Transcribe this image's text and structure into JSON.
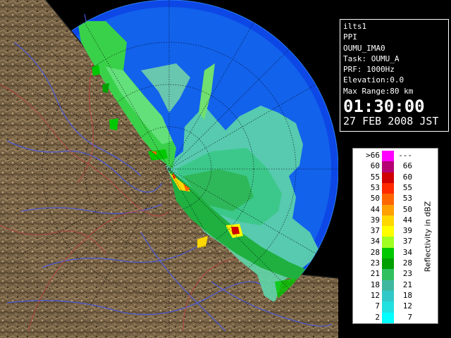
{
  "info": {
    "host": "ilts1",
    "mode": "PPI",
    "site": "OUMU_IMA0",
    "task": "Task: OUMU_A",
    "prf": "PRF: 1000Hz",
    "elevation": "Elevation:0.0",
    "max_range": "Max Range:80 km",
    "time": "01:30:00",
    "date": "27 FEB 2008 JST"
  },
  "legend": {
    "unit_label": "Reflectivity in dBZ",
    "rows": [
      {
        "low": ">66",
        "high": "---",
        "color": "#ff00ff"
      },
      {
        "low": "60",
        "high": "66",
        "color": "#b40070"
      },
      {
        "low": "55",
        "high": "60",
        "color": "#d00000"
      },
      {
        "low": "53",
        "high": "55",
        "color": "#ff2a00"
      },
      {
        "low": "50",
        "high": "53",
        "color": "#ff6600"
      },
      {
        "low": "44",
        "high": "50",
        "color": "#ffa000"
      },
      {
        "low": "39",
        "high": "44",
        "color": "#ffd800"
      },
      {
        "low": "37",
        "high": "39",
        "color": "#ffff00"
      },
      {
        "low": "34",
        "high": "37",
        "color": "#a0ff20"
      },
      {
        "low": "28",
        "high": "34",
        "color": "#00c800"
      },
      {
        "low": "23",
        "high": "28",
        "color": "#00a000"
      },
      {
        "low": "21",
        "high": "23",
        "color": "#30c060"
      },
      {
        "low": "18",
        "high": "21",
        "color": "#40b8a0"
      },
      {
        "low": "12",
        "high": "18",
        "color": "#30c8c8"
      },
      {
        "low": "7",
        "high": "12",
        "color": "#20e0e0"
      },
      {
        "low": "2",
        "high": "7",
        "color": "#00ffff"
      }
    ]
  },
  "colors": {
    "range_circle": "#0d47e6",
    "outer_circle": "#1666ee",
    "terrain": "#7a6548",
    "rivers": "#4a5ae0",
    "borders": "#c04040"
  }
}
